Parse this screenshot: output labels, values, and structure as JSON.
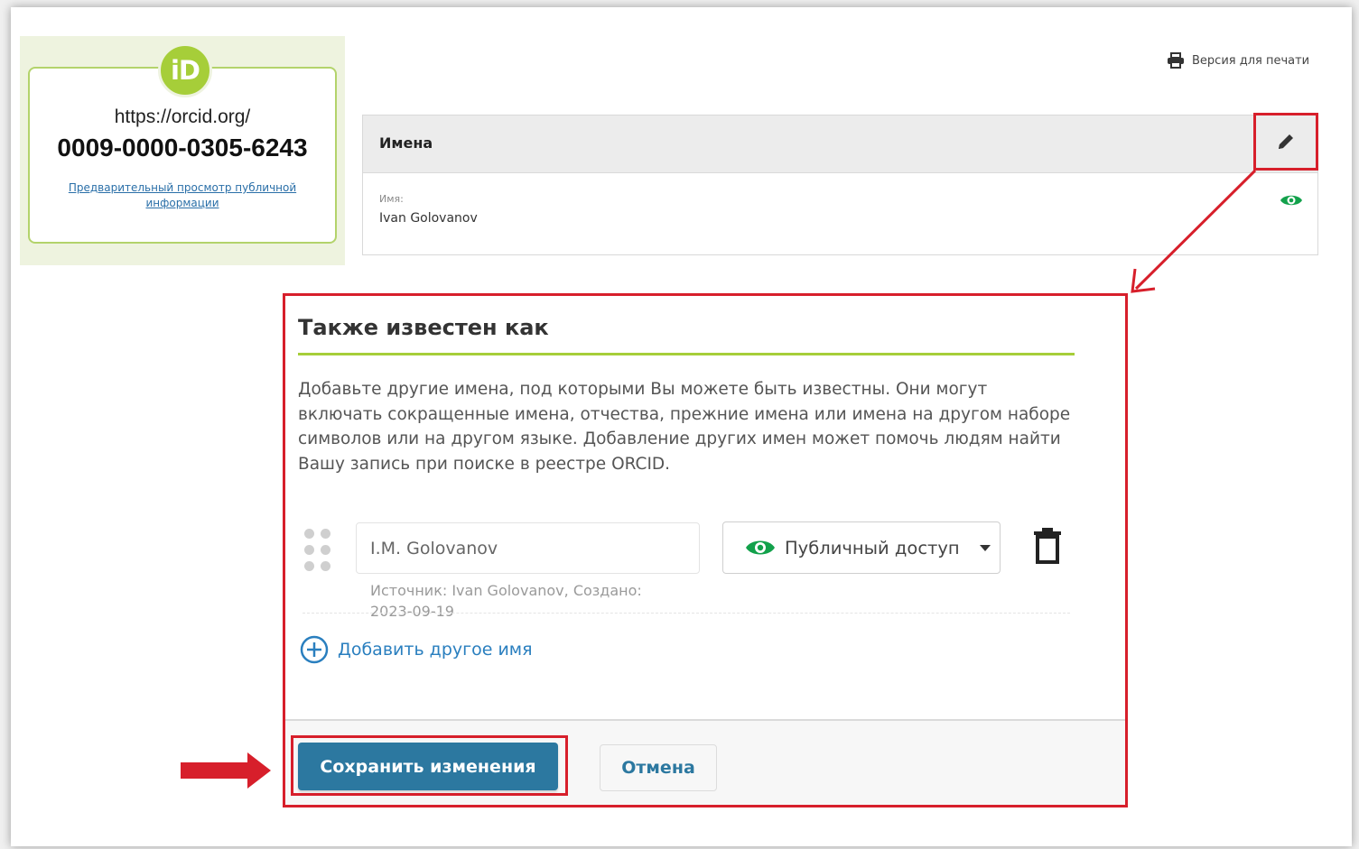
{
  "orcid": {
    "logo_text": "iD",
    "url_prefix": "https://orcid.org/",
    "id_number": "0009-0000-0305-6243",
    "preview_link": "Предварительный просмотр публичной информации"
  },
  "print_link": "Версия для печати",
  "names_panel": {
    "title": "Имена",
    "field_label": "Имя:",
    "field_value": "Ivan Golovanov",
    "visibility_icon": "eye-icon",
    "edit_icon": "pencil-icon"
  },
  "dialog": {
    "title": "Также известен как",
    "description": "Добавьте другие имена, под которыми Вы можете быть известны. Они могут включать сокращенные имена, отчества, прежние имена или имена на другом наборе символов или на другом языке. Добавление других имен может помочь людям найти Вашу запись при поиске в реестре ORCID.",
    "entry": {
      "name_value": "I.M. Golovanov",
      "visibility_label": "Публичный доступ",
      "source_text": "Источник: Ivan Golovanov, Создано: 2023-09-19"
    },
    "add_name_label": "Добавить другое имя",
    "save_label": "Сохранить изменения",
    "cancel_label": "Отмена"
  },
  "colors": {
    "orcid_green": "#a6ce39",
    "highlight_red": "#d71f2b",
    "primary_blue": "#2c78a0",
    "eye_green": "#12a14b"
  }
}
